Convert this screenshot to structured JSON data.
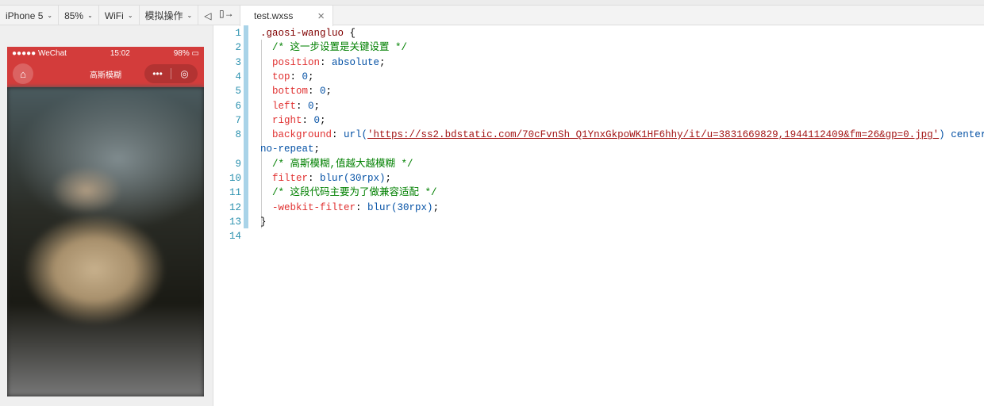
{
  "toolbar": {
    "device": "iPhone 5",
    "zoom": "85%",
    "network": "WiFi",
    "simulate": "模拟操作"
  },
  "phone": {
    "signal": "●●●●● WeChat",
    "time": "15:02",
    "battery": "98%",
    "title": "高斯模糊",
    "more": "•••",
    "target": "◎"
  },
  "tab": {
    "label": "test.wxss",
    "close": "×"
  },
  "code": [
    {
      "n": "1",
      "t": [
        [
          "sel",
          ".gaosi-wangluo "
        ],
        [
          "pun",
          "{"
        ]
      ]
    },
    {
      "n": "2",
      "t": [
        [
          "cmt",
          "  /* 这一步设置是关键设置 */"
        ]
      ]
    },
    {
      "n": "3",
      "t": [
        [
          "prop",
          "  position"
        ],
        [
          "pun",
          ": "
        ],
        [
          "val",
          "absolute"
        ],
        [
          "pun",
          ";"
        ]
      ]
    },
    {
      "n": "4",
      "t": [
        [
          "prop",
          "  top"
        ],
        [
          "pun",
          ": "
        ],
        [
          "val",
          "0"
        ],
        [
          "pun",
          ";"
        ]
      ]
    },
    {
      "n": "5",
      "t": [
        [
          "prop",
          "  bottom"
        ],
        [
          "pun",
          ": "
        ],
        [
          "val",
          "0"
        ],
        [
          "pun",
          ";"
        ]
      ]
    },
    {
      "n": "6",
      "t": [
        [
          "prop",
          "  left"
        ],
        [
          "pun",
          ": "
        ],
        [
          "val",
          "0"
        ],
        [
          "pun",
          ";"
        ]
      ]
    },
    {
      "n": "7",
      "t": [
        [
          "prop",
          "  right"
        ],
        [
          "pun",
          ": "
        ],
        [
          "val",
          "0"
        ],
        [
          "pun",
          ";"
        ]
      ]
    },
    {
      "n": "8",
      "t": [
        [
          "prop",
          "  background"
        ],
        [
          "pun",
          ": "
        ],
        [
          "val",
          "url("
        ],
        [
          "url",
          "'https://ss2.bdstatic.com/70cFvnSh_Q1YnxGkpoWK1HF6hhy/it/u=3831669829,1944112409&fm=26&gp=0.jpg'"
        ],
        [
          "val",
          ")"
        ],
        [
          "val",
          " center/cover"
        ]
      ]
    },
    {
      "n": "",
      "t": [
        [
          "val",
          "no-repeat"
        ],
        [
          "pun",
          ";"
        ]
      ]
    },
    {
      "n": "9",
      "t": [
        [
          "cmt",
          "  /* 高斯模糊,值越大越模糊 */"
        ]
      ]
    },
    {
      "n": "10",
      "t": [
        [
          "prop",
          "  filter"
        ],
        [
          "pun",
          ": "
        ],
        [
          "val",
          "blur(30rpx)"
        ],
        [
          "pun",
          ";"
        ]
      ]
    },
    {
      "n": "11",
      "t": [
        [
          "cmt",
          "  /* 这段代码主要为了做兼容适配 */"
        ]
      ]
    },
    {
      "n": "12",
      "t": [
        [
          "prop",
          "  -webkit-filter"
        ],
        [
          "pun",
          ": "
        ],
        [
          "val",
          "blur(30rpx)"
        ],
        [
          "pun",
          ";"
        ]
      ]
    },
    {
      "n": "13",
      "t": [
        [
          "pun",
          "}"
        ]
      ]
    },
    {
      "n": "14",
      "t": []
    }
  ]
}
